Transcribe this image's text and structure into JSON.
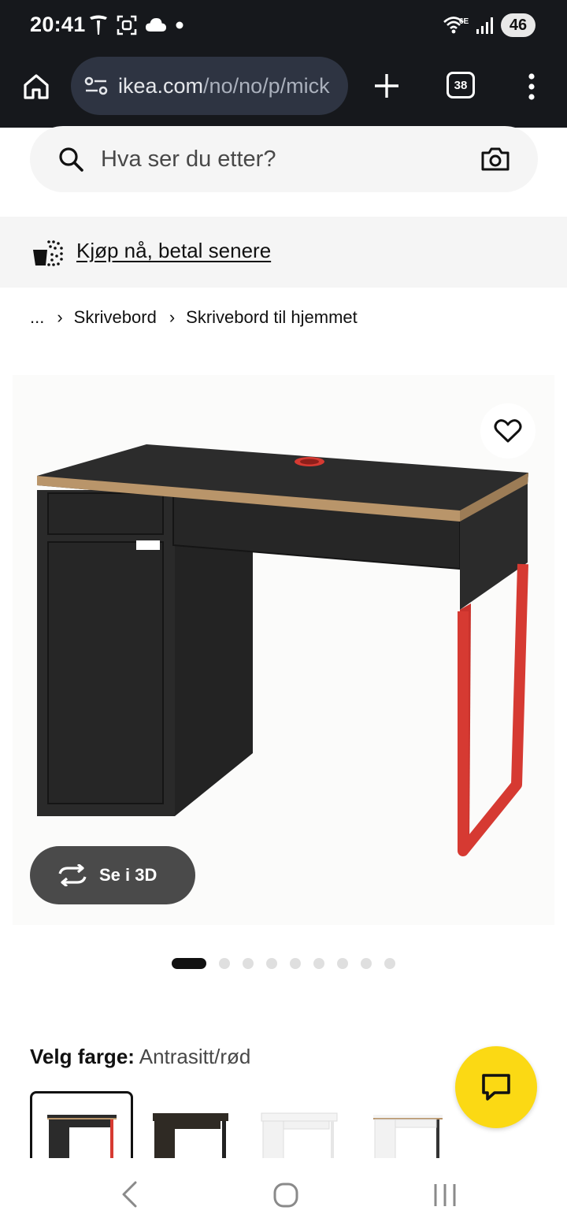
{
  "status_bar": {
    "time": "20:41",
    "network_label": "6E",
    "battery": "46"
  },
  "browser": {
    "url_domain": "ikea.com",
    "url_path": "/no/no/p/mick",
    "tab_count": "38"
  },
  "search": {
    "placeholder": "Hva ser du etter?"
  },
  "promo": {
    "link_text": "Kjøp nå, betal senere"
  },
  "breadcrumb": {
    "ellipsis": "...",
    "items": [
      "Skrivebord",
      "Skrivebord til hjemmet"
    ]
  },
  "product_image": {
    "view_3d_label": "Se i 3D",
    "carousel_count": 9,
    "carousel_active": 1
  },
  "color_selector": {
    "label": "Velg farge:",
    "value": "Antrasitt/rød",
    "options": [
      "Antrasitt/rød",
      "Svartbrun",
      "Hvit",
      "Hvit/eik"
    ]
  },
  "colors": {
    "brand_yellow": "#FBD914",
    "desk_top": "#2b2b2b",
    "desk_leg": "#d63a32",
    "toolbar_bg": "#16181c"
  }
}
